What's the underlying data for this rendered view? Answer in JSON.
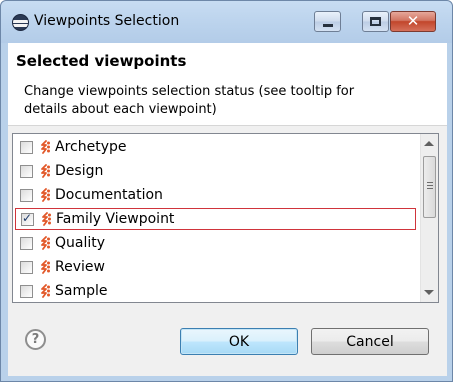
{
  "window": {
    "title": "Viewpoints Selection",
    "minimize_glyph": "",
    "close_glyph": "✕"
  },
  "header": {
    "title": "Selected viewpoints",
    "description": "Change viewpoints selection status (see tooltip for details about each viewpoint)"
  },
  "viewpoints": [
    {
      "label": "Archetype",
      "checked": false,
      "icon": "viewpoint-icon"
    },
    {
      "label": "Design",
      "checked": false,
      "icon": "viewpoint-icon"
    },
    {
      "label": "Documentation",
      "checked": false,
      "icon": "viewpoint-icon"
    },
    {
      "label": "Family Viewpoint",
      "checked": true,
      "icon": "viewpoint-icon"
    },
    {
      "label": "Quality",
      "checked": false,
      "icon": "viewpoint-icon"
    },
    {
      "label": "Review",
      "checked": false,
      "icon": "viewpoint-icon"
    },
    {
      "label": "Sample",
      "checked": false,
      "icon": "viewpoint-icon"
    }
  ],
  "buttons": {
    "help": "?",
    "ok": "OK",
    "cancel": "Cancel"
  },
  "colors": {
    "selection_border": "#d0343b",
    "viewpoint_icon": "#e2592a",
    "ok_border": "#3c7fb1"
  }
}
